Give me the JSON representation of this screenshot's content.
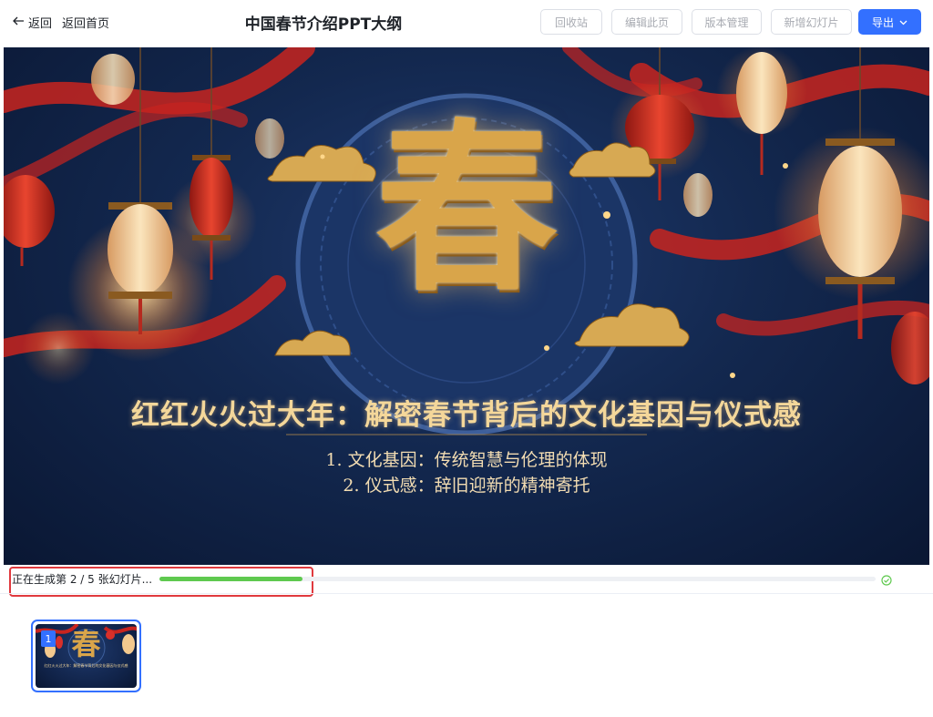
{
  "header": {
    "back_label": "返回",
    "home_label": "返回首页",
    "title": "中国春节介绍PPT大纲",
    "buttons": {
      "recycle": "回收站",
      "edit": "编辑此页",
      "versions": "版本管理",
      "add_slide": "新增幻灯片",
      "export": "导出"
    }
  },
  "slide": {
    "big_char": "春",
    "title": "红红火火过大年：解密春节背后的文化基因与仪式感",
    "lines": [
      "1. 文化基因：传统智慧与伦理的体现",
      "2. 仪式感：辞旧迎新的精神寄托"
    ]
  },
  "progress": {
    "text": "正在生成第 2 / 5 张幻灯片...",
    "fraction": 0.2
  },
  "thumbnails": [
    {
      "number": "1",
      "char": "春",
      "caption": "红红火火过大年：解密春节背后的文化基因与仪式感"
    }
  ],
  "colors": {
    "accent": "#3370ff",
    "progress": "#5fc94f",
    "highlight_border": "#e0393e",
    "slide_bg": "#13284f",
    "gold": "#d9a54a",
    "lantern": "#d8302a"
  },
  "icons": {
    "back": "arrow-left-icon",
    "export_dropdown": "chevron-down-icon",
    "progress_done": "check-circle-icon"
  }
}
